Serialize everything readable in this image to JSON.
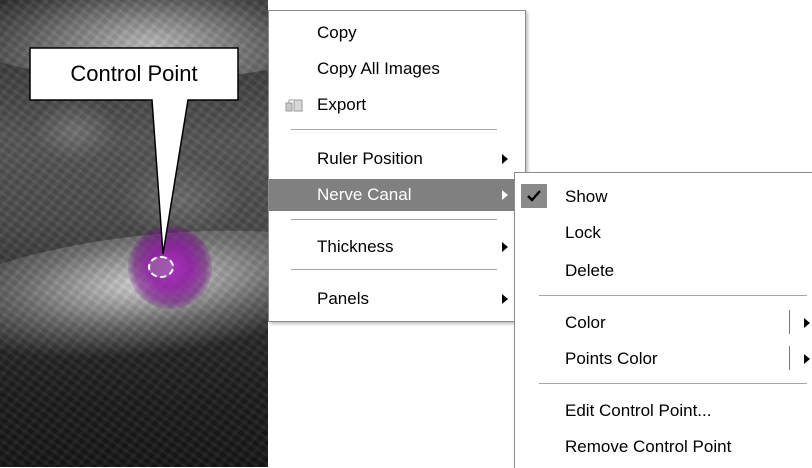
{
  "callout": {
    "label": "Control Point"
  },
  "context_menu": {
    "items": [
      {
        "label": "Copy"
      },
      {
        "label": "Copy All Images"
      },
      {
        "label": "Export",
        "icon": "export-icon"
      },
      {
        "label": "Ruler Position",
        "has_submenu": true
      },
      {
        "label": "Nerve Canal",
        "has_submenu": true,
        "highlighted": true
      },
      {
        "label": "Thickness",
        "has_submenu": true
      },
      {
        "label": "Panels",
        "has_submenu": true
      }
    ]
  },
  "nerve_canal_submenu": {
    "items": [
      {
        "label": "Show",
        "checked": true,
        "icon": "checkmark-icon"
      },
      {
        "label": "Lock"
      },
      {
        "label": "Delete"
      },
      {
        "label": "Color",
        "has_submenu": true
      },
      {
        "label": "Points Color",
        "has_submenu": true
      },
      {
        "label": "Edit Control Point..."
      },
      {
        "label": "Remove Control Point"
      }
    ]
  },
  "colors": {
    "highlight": "#808080",
    "control_point_glow": "#8c14a0",
    "check_background": "#8a8a8a"
  }
}
